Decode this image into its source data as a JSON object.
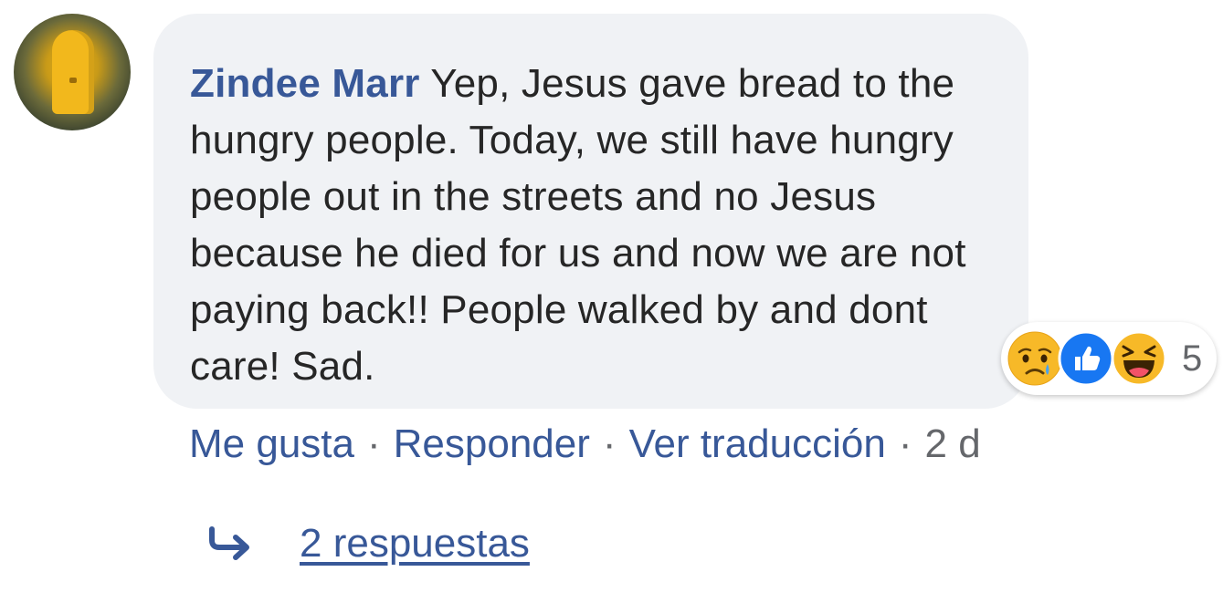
{
  "comment": {
    "author": "Zindee Marr",
    "text": "Yep, Jesus gave bread to the hungry people. Today, we still have hungry people out in the streets and no Jesus because he died for us and now we are not paying back!! People walked by and dont care! Sad."
  },
  "reactions": {
    "icons": [
      "sad-icon",
      "like-icon",
      "haha-icon"
    ],
    "count": "5"
  },
  "actions": {
    "like": "Me gusta",
    "reply": "Responder",
    "translate": "Ver traducción",
    "separator": "·",
    "time": "2 d"
  },
  "replies": {
    "label": "2 respuestas"
  },
  "colors": {
    "link": "#385898",
    "bubble": "#f0f2f5",
    "meta": "#65676b",
    "like_blue": "#1877f2",
    "reaction_yellow": "#f7b928"
  }
}
